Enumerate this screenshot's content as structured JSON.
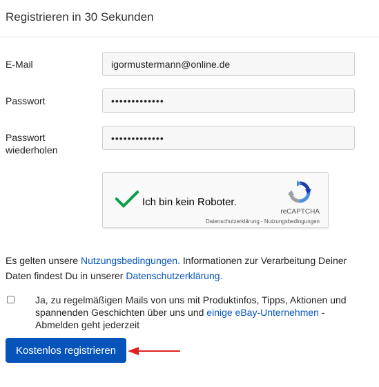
{
  "page_title": "Registrieren in 30 Sekunden",
  "form": {
    "email": {
      "label": "E-Mail",
      "value": "igormustermann@online.de"
    },
    "password": {
      "label": "Passwort",
      "value": "•••••••••••••"
    },
    "password_repeat": {
      "label_line1": "Passwort",
      "label_line2": "wiederholen",
      "value": "•••••••••••••"
    }
  },
  "captcha": {
    "label": "Ich bin kein Roboter.",
    "brand": "reCAPTCHA",
    "privacy_link": "Datenschutzerklärung",
    "separator": " - ",
    "terms_link": "Nutzungsbedingungen",
    "checked": true
  },
  "terms": {
    "text1": "Es gelten unsere ",
    "link1": "Nutzungsbedingungen.",
    "text2": " Informationen zur Verarbeitung Deiner Daten findest Du in unserer ",
    "link2": "Datenschutzerklärung."
  },
  "newsletter": {
    "text1": "Ja, zu regelmäßigen Mails von uns mit Produktinfos, Tipps, Aktionen und spannenden Geschichten über uns und ",
    "link": "einige eBay-Unternehmen",
    "text2": " - Abmelden geht jederzeit",
    "checked": false
  },
  "submit_label": "Kostenlos registrieren",
  "colors": {
    "accent": "#0654ba",
    "check_green": "#0a9e48",
    "arrow_red": "#e02020"
  }
}
